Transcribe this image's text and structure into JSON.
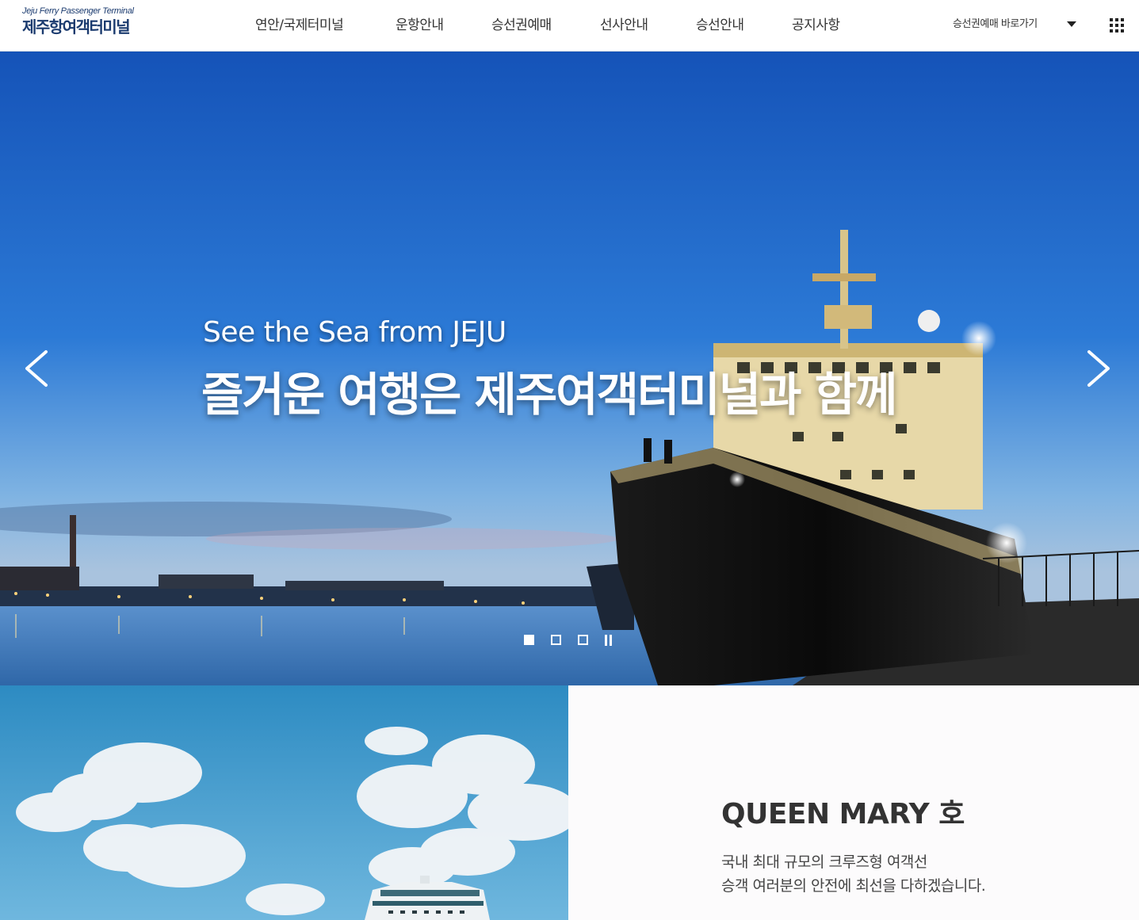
{
  "header": {
    "logo_en": "Jeju Ferry Passenger Terminal",
    "logo_ko": "제주항여객터미널",
    "nav": [
      "연안/국제터미널",
      "운항안내",
      "승선권예매",
      "선사안내",
      "승선안내",
      "공지사항"
    ],
    "quick_link": "승선권예매 바로가기",
    "quick_link_icon": "chevron-down-icon",
    "menu_icon": "grid-menu-icon"
  },
  "hero": {
    "subtitle": "See the Sea from JEJU",
    "title": "즐거운 여행은 제주여객터미널과 함께",
    "prev_icon": "chevron-left-icon",
    "next_icon": "chevron-right-icon",
    "slides_total": 3,
    "active_slide": 1,
    "pause_icon": "pause-icon"
  },
  "feature": {
    "title": "QUEEN MARY 호",
    "desc_line1": "국내 최대 규모의 크루즈형 여객선",
    "desc_line2": "승객 여러분의 안전에 최선을 다하겠습니다."
  },
  "colors": {
    "brand": "#1b3b6f",
    "sky_top": "#1553b8",
    "sky_mid": "#2c7ad6",
    "water": "#6d9fd0"
  }
}
